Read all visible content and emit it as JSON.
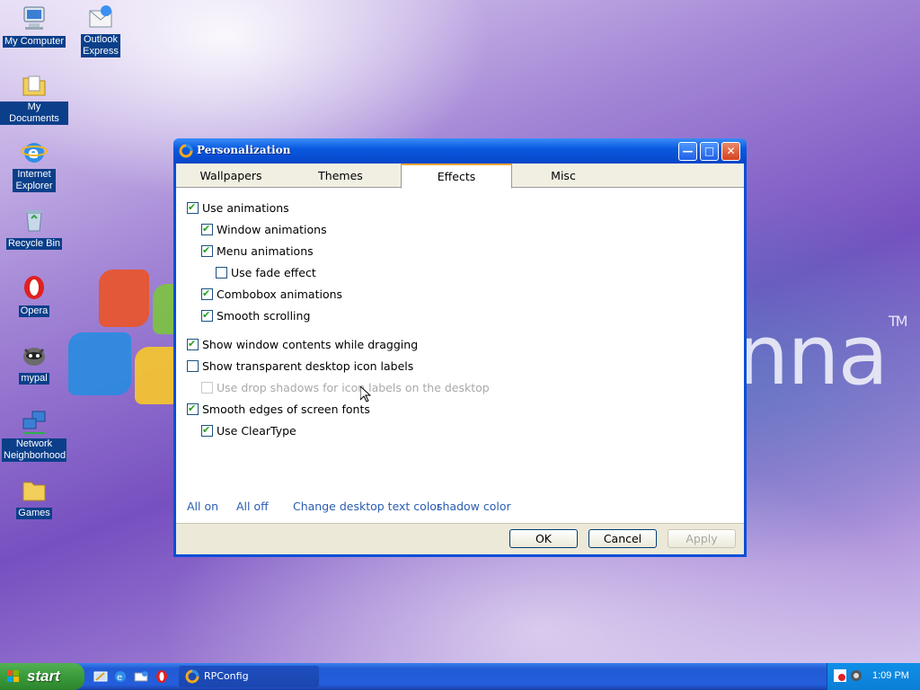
{
  "desktop": {
    "icons": [
      {
        "label": "My Computer",
        "icon": "my-computer-icon"
      },
      {
        "label": "Outlook Express",
        "icon": "outlook-express-icon"
      },
      {
        "label": "My Documents",
        "icon": "my-documents-icon"
      },
      {
        "label": "Internet Explorer",
        "icon": "internet-explorer-icon"
      },
      {
        "label": "Recycle Bin",
        "icon": "recycle-bin-icon"
      },
      {
        "label": "Opera",
        "icon": "opera-icon"
      },
      {
        "label": "mypal",
        "icon": "mypal-icon"
      },
      {
        "label": "Network Neighborhood",
        "icon": "network-neighborhood-icon"
      },
      {
        "label": "Games",
        "icon": "games-folder-icon"
      }
    ],
    "brand_text": "nna",
    "brand_mark": "TM"
  },
  "window": {
    "title": "Personalization",
    "tabs": [
      {
        "label": "Wallpapers",
        "active": false
      },
      {
        "label": "Themes",
        "active": false
      },
      {
        "label": "Effects",
        "active": true
      },
      {
        "label": "Misc",
        "active": false
      }
    ],
    "options": [
      {
        "label": "Use animations",
        "checked": true,
        "enabled": true
      },
      {
        "label": "Window animations",
        "checked": true,
        "enabled": true
      },
      {
        "label": "Menu animations",
        "checked": true,
        "enabled": true
      },
      {
        "label": "Use fade effect",
        "checked": false,
        "enabled": true
      },
      {
        "label": "Combobox animations",
        "checked": true,
        "enabled": true
      },
      {
        "label": "Smooth scrolling",
        "checked": true,
        "enabled": true
      },
      {
        "label": "Show window contents while dragging",
        "checked": true,
        "enabled": true
      },
      {
        "label": "Show transparent desktop icon labels",
        "checked": false,
        "enabled": true
      },
      {
        "label": "Use drop shadows for icon labels on the desktop",
        "checked": false,
        "enabled": false
      },
      {
        "label": "Smooth edges of screen fonts",
        "checked": true,
        "enabled": true
      },
      {
        "label": "Use ClearType",
        "checked": true,
        "enabled": true
      }
    ],
    "links": {
      "all_on": "All on",
      "all_off": "All off",
      "change_text_color": "Change desktop text color",
      "shadow_color": "shadow color"
    },
    "buttons": {
      "ok": "OK",
      "cancel": "Cancel",
      "apply": "Apply"
    }
  },
  "taskbar": {
    "start_label": "start",
    "task_label": "RPConfig",
    "clock": "1:09 PM"
  },
  "colors": {
    "titlebar": "#0a5ae0",
    "link": "#2a5db0",
    "check": "#21a121",
    "start_green": "#3a9b3a"
  }
}
